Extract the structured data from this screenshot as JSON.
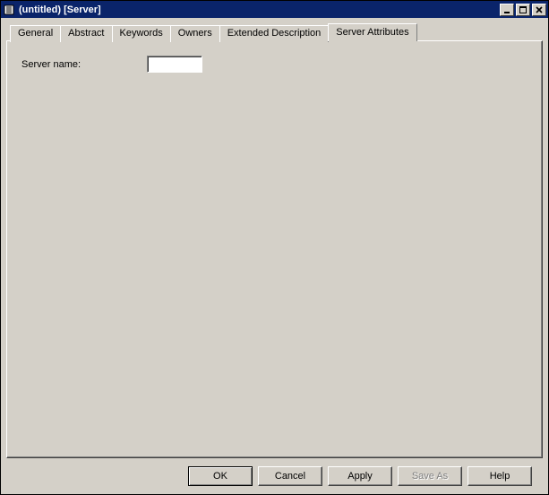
{
  "title": "(untitled) [Server]",
  "tabs": [
    {
      "label": "General"
    },
    {
      "label": "Abstract"
    },
    {
      "label": "Keywords"
    },
    {
      "label": "Owners"
    },
    {
      "label": "Extended Description"
    },
    {
      "label": "Server Attributes"
    }
  ],
  "activeTabIndex": 5,
  "form": {
    "server_name_label": "Server name:",
    "server_name_value": ""
  },
  "buttons": {
    "ok": "OK",
    "cancel": "Cancel",
    "apply": "Apply",
    "saveas": "Save As",
    "help": "Help"
  }
}
